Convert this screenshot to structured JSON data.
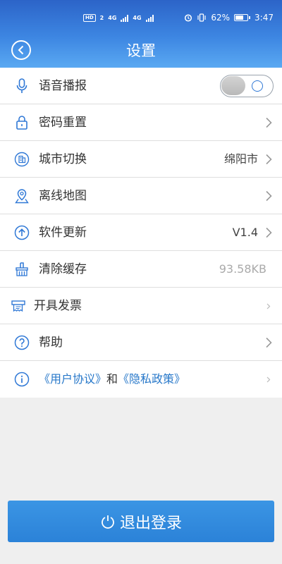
{
  "status_bar": {
    "network_left": "HD",
    "sim1": "2",
    "net1": "4G",
    "net2": "4G",
    "battery": "62%",
    "time": "3:47"
  },
  "nav": {
    "title": "设置"
  },
  "settings": {
    "voice_broadcast": {
      "label": "语音播报",
      "toggle_on": false
    },
    "password_reset": {
      "label": "密码重置"
    },
    "city_switch": {
      "label": "城市切换",
      "value": "绵阳市"
    },
    "offline_map": {
      "label": "离线地图"
    },
    "software_update": {
      "label": "软件更新",
      "value": "V1.4"
    },
    "clear_cache": {
      "label": "清除缓存",
      "value": "93.58KB"
    },
    "invoice": {
      "label": "开具发票"
    },
    "help": {
      "label": "帮助"
    },
    "agreement": {
      "user_agreement": "《用户协议》",
      "and": "和",
      "privacy_policy": "《隐私政策》"
    }
  },
  "logout": {
    "label": "退出登录"
  },
  "colors": {
    "header_top": "#2c64c8",
    "header_bottom": "#5aa9f2",
    "link": "#2677c9",
    "button": "#3390e0"
  }
}
